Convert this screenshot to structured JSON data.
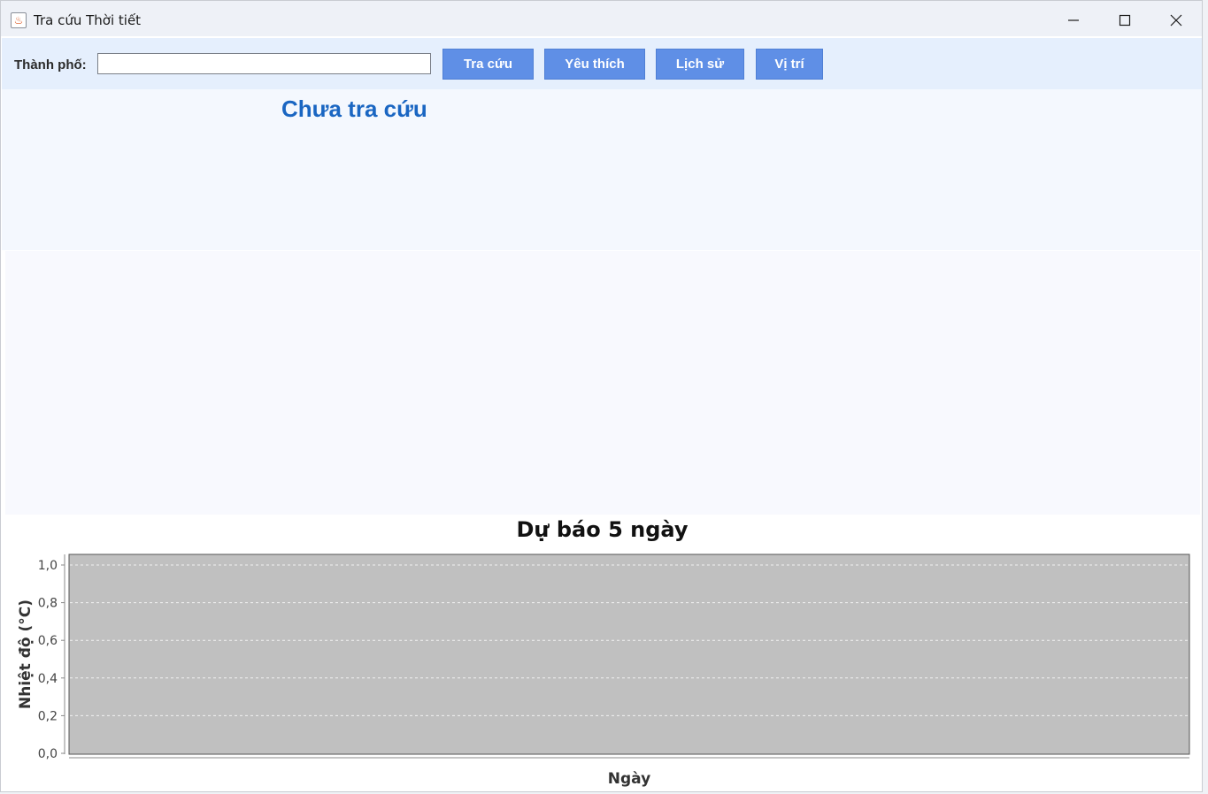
{
  "window": {
    "title": "Tra cứu Thời tiết",
    "controls": [
      "minimize-icon",
      "maximize-icon",
      "close-icon"
    ]
  },
  "toolbar": {
    "city_label": "Thành phố:",
    "city_input_value": "",
    "buttons": {
      "search": "Tra cứu",
      "favorites": "Yêu thích",
      "history": "Lịch sử",
      "location": "Vị trí"
    },
    "accent_color": "#5f8fe6"
  },
  "status": {
    "text": "Chưa tra cứu",
    "color": "#1a66c2"
  },
  "chart_data": {
    "type": "bar",
    "title": "Dự báo 5 ngày",
    "xlabel": "Ngày",
    "ylabel": "Nhiệt độ (°C)",
    "categories": [],
    "values": [],
    "ylim": [
      0.0,
      1.0
    ],
    "yticks": [
      "0,0",
      "0,2",
      "0,4",
      "0,6",
      "0,8",
      "1,0"
    ],
    "grid": true,
    "legend": "none",
    "plot_background": "#c0c0c0"
  }
}
